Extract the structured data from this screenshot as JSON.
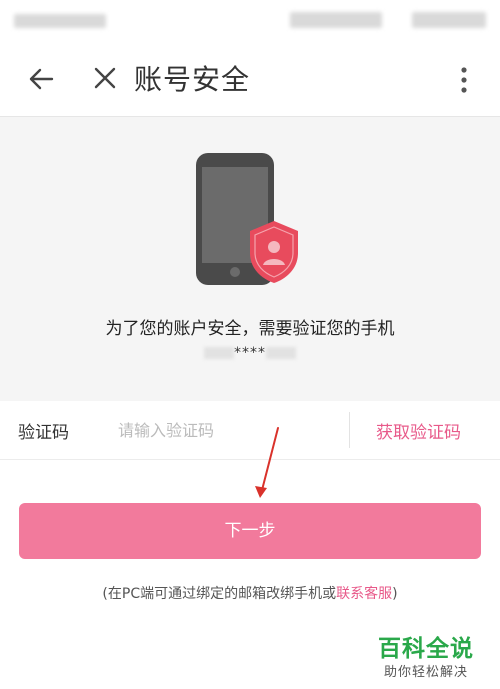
{
  "header": {
    "title": "账号安全"
  },
  "hero": {
    "message": "为了您的账户安全，需要验证您的手机",
    "masked_phone": "****"
  },
  "verification": {
    "label": "验证码",
    "placeholder": "请输入验证码",
    "get_code_label": "获取验证码"
  },
  "actions": {
    "next_label": "下一步"
  },
  "footer": {
    "hint_prefix": "(在PC端可通过绑定的邮箱改绑手机或",
    "contact_label": "联系客服",
    "hint_suffix": ")"
  },
  "watermark": {
    "title": "百科全说",
    "subtitle": "助你轻松解决"
  },
  "colors": {
    "accent": "#e85a8a",
    "button": "#f27a9c",
    "shield": "#e84b5d",
    "hero_background": "#f5f5f5"
  },
  "icons": {
    "back": "arrow-left-icon",
    "close": "close-icon",
    "more": "more-vertical-icon",
    "phone": "smartphone-icon",
    "shield": "shield-user-icon"
  }
}
